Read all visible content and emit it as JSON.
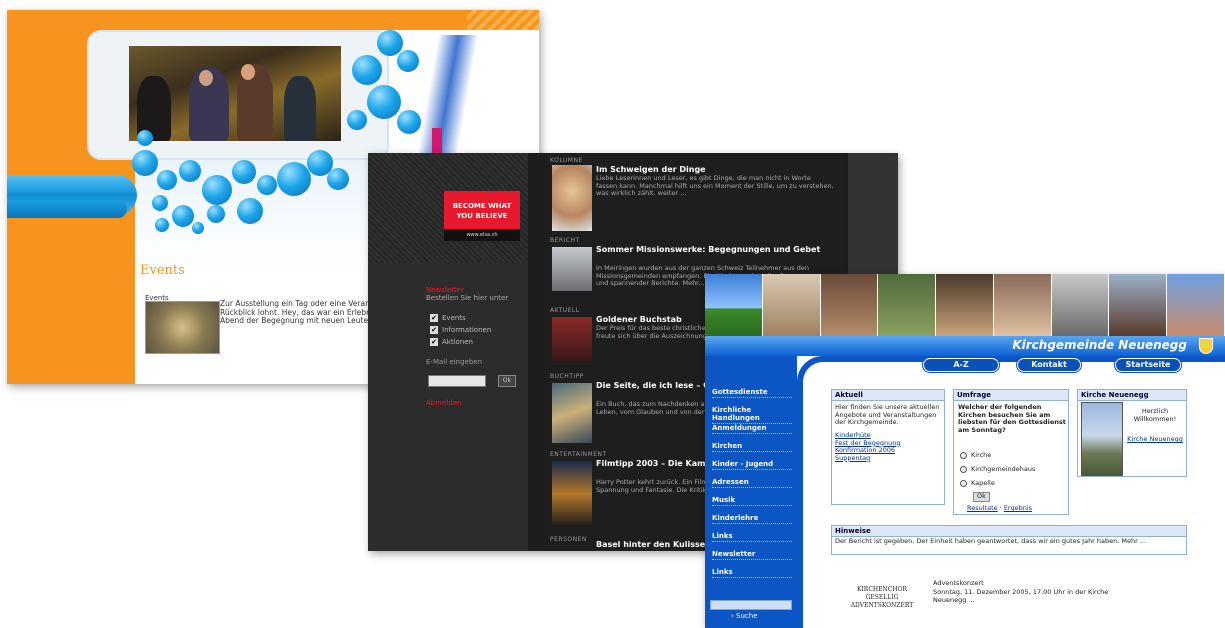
{
  "shot1": {
    "events_title": "Events",
    "events_label": "Events",
    "events_text": "Zur Ausstellung ein Tag oder eine Veranstaltung, die uns beschäftigt und einen Rückblick lohnt. Hey, das war ein Erlebnis mit den Freunden, den Kollegen und ein Abend der Begegnung mit neuen Leuten aus der Region. Mehr davon ..."
  },
  "shot2": {
    "banner_text": "BECOME WHAT YOU BELIEVE",
    "banner_sub": "www.elsa.ch",
    "newsletter_title": "Newsletter",
    "newsletter_sub": "Bestellen Sie hier unter",
    "checkboxes": [
      "Events",
      "Informationen",
      "Aktionen"
    ],
    "email_label": "E-Mail eingeben",
    "ok_label": "Ok",
    "abmelden": "Abmelden",
    "items": [
      {
        "cat": "Kolumne",
        "title": "Im Schweigen der Dinge",
        "body": "Liebe Leserinnen und Leser, es gibt Dinge, die man nicht in Worte fassen kann. Manchmal hilft uns ein Moment der Stille, um zu verstehen, was wirklich zählt. weiter ..."
      },
      {
        "cat": "Bericht",
        "title": "Sommer Missionswerke: Begegnungen und Gebet",
        "body": "In Meiringen wurden aus der ganzen Schweiz Teilnehmer aus den Missionsgemeinden empfangen. Ein Wochenende voller Begegnungen und spannender Berichte. Mehr..."
      },
      {
        "cat": "Aktuell",
        "title": "Goldener Buchstab",
        "body": "Der Preis für das beste christliche Buch wurde verliehen. Der Autor freute sich über die Auszeichnung und die vielen Leser. weiter lesen ..."
      },
      {
        "cat": "Buchtipp",
        "title": "Die Seite, die ich lese – Gedanken in Ruhe",
        "body": "Ein Buch, das zum Nachdenken anregt und Mut macht. Geschichten vom Leben, vom Glauben und von der Hoffnung. weiter ..."
      },
      {
        "cat": "Entertainment",
        "title": "Filmtipp 2003 – Die Kammer des Schreckens",
        "body": "Harry Potter kehrt zurück. Ein Film für die ganze Familie mit viel Spannung und Fantasie. Die Kritik. weiter ..."
      },
      {
        "cat": "Personen",
        "title": "Basel hinter den Kulissen",
        "body": ""
      }
    ]
  },
  "shot3": {
    "site_title": "Kirchgemeinde Neuenegg",
    "topnav": [
      "A-Z",
      "Kontakt",
      "Startseite"
    ],
    "sidebar": [
      "Gottesdienste",
      "Kirchliche Handlungen",
      "Anmeldungen",
      "Kirchen",
      "Kinder - Jugend",
      "Adressen",
      "Musik",
      "Kinderlehre",
      "Links",
      "Newsletter",
      "Links"
    ],
    "search_label": "Suche",
    "aktuell": {
      "head": "Aktuell",
      "text": "Hier finden Sie unsere aktuellen Angebote und Veranstaltungen der Kirchgemeinde.",
      "links": [
        "Kinderhüte",
        "Fest der Begegnung",
        "Konfirmation 2006",
        "Suppentag"
      ]
    },
    "umfrage": {
      "head": "Umfrage",
      "question": "Welcher der folgenden Kirchen besuchen Sie am liebsten für den Gottesdienst am Sonntag?",
      "options": [
        "Kirche",
        "Kirchgemeindehaus",
        "Kapelle"
      ],
      "button": "Ok",
      "links": [
        "Resultate",
        "Ergebnis"
      ]
    },
    "kirche": {
      "head": "Kirche Neuenegg",
      "greeting": "Herzlich Willkommen!",
      "link": "Kirche Neuenegg"
    },
    "footer_head": "Hinweise",
    "footer_text": "Der Bericht ist gegeben. Der Einheit haben geantwortet, dass wir ein gutes Jahr haben. Mehr ...",
    "concert_text": "KIRCHENCHOR GESELLIG ADVENTSKONZERT",
    "concert_title": "Adventskonzert",
    "concert_body": "Sonntag, 11. Dezember 2005, 17.00 Uhr in der Kirche Neuenegg ..."
  }
}
